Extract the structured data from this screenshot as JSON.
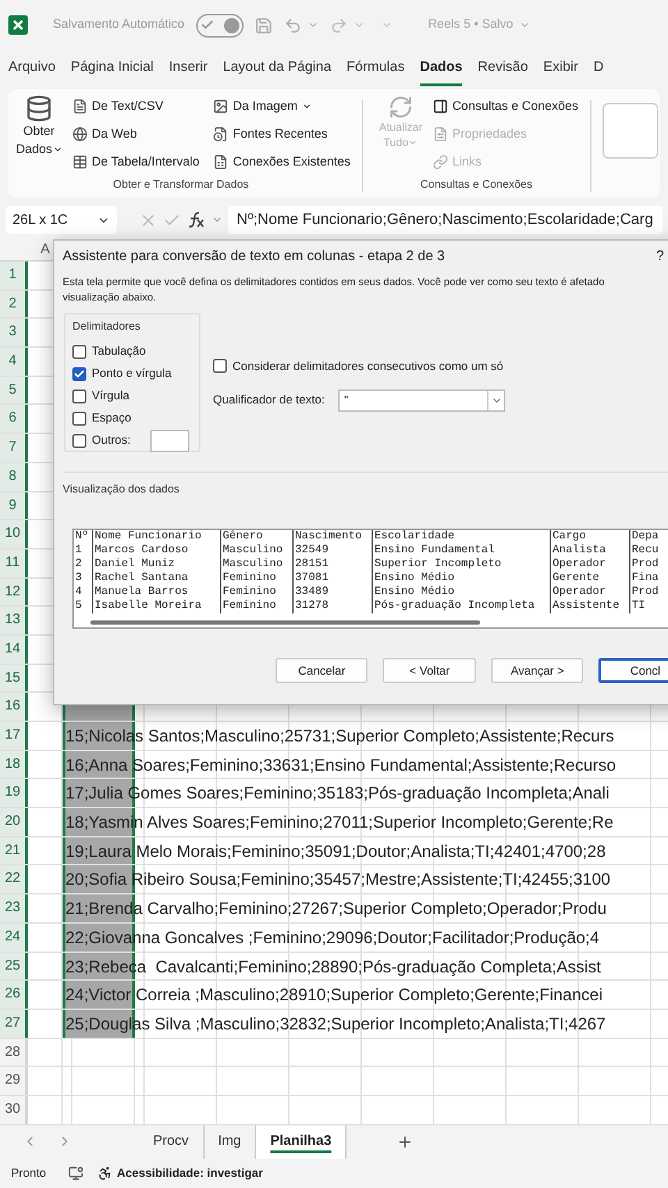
{
  "title_bar": {
    "autosave_label": "Salvamento Automático",
    "autosave_on": true,
    "document": "Reels 5 • Salvo"
  },
  "menu_tabs": [
    {
      "label": "Arquivo",
      "selected": false
    },
    {
      "label": "Página Inicial",
      "selected": false
    },
    {
      "label": "Inserir",
      "selected": false
    },
    {
      "label": "Layout da Página",
      "selected": false
    },
    {
      "label": "Fórmulas",
      "selected": false
    },
    {
      "label": "Dados",
      "selected": true
    },
    {
      "label": "Revisão",
      "selected": false
    },
    {
      "label": "Exibir",
      "selected": false
    },
    {
      "label": "D",
      "selected": false
    }
  ],
  "ribbon": {
    "get_data": {
      "large_button": {
        "line1": "Obter",
        "line2": "Dados"
      },
      "items": [
        {
          "label": "De Text/CSV",
          "has_menu": false
        },
        {
          "label": "Da Web",
          "has_menu": false
        },
        {
          "label": "De Tabela/Intervalo",
          "has_menu": false
        },
        {
          "label": "Da Imagem",
          "has_menu": true
        },
        {
          "label": "Fontes Recentes",
          "has_menu": false
        },
        {
          "label": "Conexões Existentes",
          "has_menu": false
        }
      ],
      "group_label": "Obter e Transformar Dados"
    },
    "queries": {
      "large_button": {
        "line1": "Atualizar",
        "line2": "Tudo",
        "disabled": true
      },
      "items": [
        {
          "label": "Consultas e Conexões",
          "disabled": false
        },
        {
          "label": "Propriedades",
          "disabled": true
        },
        {
          "label": "Links",
          "disabled": true
        }
      ],
      "group_label": "Consultas e Conexões"
    }
  },
  "formula_bar": {
    "name_box": "26L x 1C",
    "formula": "Nº;Nome Funcionario;Gênero;Nascimento;Escolaridade;Carg"
  },
  "sheet": {
    "column_headers": [
      "A"
    ],
    "rows": [
      {
        "number": "1",
        "in_selection": true
      },
      {
        "number": "2",
        "in_selection": true
      },
      {
        "number": "3",
        "in_selection": true
      },
      {
        "number": "4",
        "in_selection": true
      },
      {
        "number": "5",
        "in_selection": true
      },
      {
        "number": "6",
        "in_selection": true
      },
      {
        "number": "7",
        "in_selection": true
      },
      {
        "number": "8",
        "in_selection": true
      },
      {
        "number": "9",
        "in_selection": true
      },
      {
        "number": "10",
        "in_selection": true
      },
      {
        "number": "11",
        "in_selection": true
      },
      {
        "number": "12",
        "in_selection": true
      },
      {
        "number": "13",
        "in_selection": true
      },
      {
        "number": "14",
        "in_selection": true
      },
      {
        "number": "15",
        "in_selection": true
      },
      {
        "number": "16",
        "in_selection": true
      },
      {
        "number": "17",
        "in_selection": true,
        "text": "15;Nicolas Santos;Masculino;25731;Superior Completo;Assistente;Recurs"
      },
      {
        "number": "18",
        "in_selection": true,
        "text": "16;Anna Soares;Feminino;33631;Ensino Fundamental;Assistente;Recurso"
      },
      {
        "number": "19",
        "in_selection": true,
        "text": "17;Julia Gomes Soares;Feminino;35183;Pós-graduação Incompleta;Anali"
      },
      {
        "number": "20",
        "in_selection": true,
        "text": "18;Yasmin Alves Soares;Feminino;27011;Superior Incompleto;Gerente;Re"
      },
      {
        "number": "21",
        "in_selection": true,
        "text": "19;Laura Melo Morais;Feminino;35091;Doutor;Analista;TI;42401;4700;28"
      },
      {
        "number": "22",
        "in_selection": true,
        "text": "20;Sofia Ribeiro Sousa;Feminino;35457;Mestre;Assistente;TI;42455;3100"
      },
      {
        "number": "23",
        "in_selection": true,
        "text": "21;Brenda Carvalho;Feminino;27267;Superior Completo;Operador;Produ"
      },
      {
        "number": "24",
        "in_selection": true,
        "text": "22;Giovanna Goncalves ;Feminino;29096;Doutor;Facilitador;Produção;4"
      },
      {
        "number": "25",
        "in_selection": true,
        "text": "23;Rebeca  Cavalcanti;Feminino;28890;Pós-graduação Completa;Assist"
      },
      {
        "number": "26",
        "in_selection": true,
        "text": "24;Victor Correia ;Masculino;28910;Superior Completo;Gerente;Financei"
      },
      {
        "number": "27",
        "in_selection": true,
        "text": "25;Douglas Silva ;Masculino;32832;Superior Incompleto;Analista;TI;4267"
      },
      {
        "number": "28",
        "in_selection": false
      },
      {
        "number": "29",
        "in_selection": false
      },
      {
        "number": "30",
        "in_selection": false
      }
    ]
  },
  "dialog": {
    "title": "Assistente para conversão de texto em colunas - etapa 2 de 3",
    "help": "?",
    "description_lines": [
      "Esta tela permite que você defina os delimitadores contidos em seus dados. Você pode ver como seu texto é afetado",
      "visualização abaixo."
    ],
    "delimiters": {
      "label": "Delimitadores",
      "options": [
        {
          "label": "Tabulação",
          "checked": false
        },
        {
          "label": "Ponto e vírgula",
          "checked": true
        },
        {
          "label": "Vírgula",
          "checked": false
        },
        {
          "label": "Espaço",
          "checked": false
        },
        {
          "label": "Outros:",
          "checked": false
        }
      ]
    },
    "consecutive": {
      "label": "Considerar delimitadores consecutivos como um só",
      "checked": false
    },
    "qualifier": {
      "label": "Qualificador de texto:",
      "value": "\""
    },
    "preview": {
      "label": "Visualização dos dados",
      "rows": [
        [
          "Nº",
          "Nome Funcionario",
          "Gênero",
          "Nascimento",
          "Escolaridade",
          "Cargo",
          "Depa"
        ],
        [
          "1",
          "Marcos Cardoso",
          "Masculino",
          "32549",
          "Ensino Fundamental",
          "Analista",
          "Recu"
        ],
        [
          "2",
          "Daniel Muniz",
          "Masculino",
          "28151",
          "Superior Incompleto",
          "Operador",
          "Prod"
        ],
        [
          "3",
          "Rachel Santana",
          "Feminino",
          "37081",
          "Ensino Médio",
          "Gerente",
          "Fina"
        ],
        [
          "4",
          "Manuela Barros",
          "Feminino",
          "33489",
          "Ensino Médio",
          "Operador",
          "Prod"
        ],
        [
          "5",
          "Isabelle Moreira",
          "Feminino",
          "31278",
          "Pós-graduação Incompleta",
          "Assistente",
          "TI"
        ]
      ]
    },
    "buttons": [
      {
        "label": "Cancelar",
        "default": false
      },
      {
        "label": "< Voltar",
        "default": false
      },
      {
        "label": "Avançar >",
        "default": false
      },
      {
        "label": "Concl",
        "default": true
      }
    ]
  },
  "sheet_tabs": [
    {
      "label": "Procv",
      "selected": false
    },
    {
      "label": "Img",
      "selected": false
    },
    {
      "label": "Planilha3",
      "selected": true
    }
  ],
  "status_bar": {
    "status": "Pronto",
    "accessibility": "Acessibilidade: investigar"
  }
}
